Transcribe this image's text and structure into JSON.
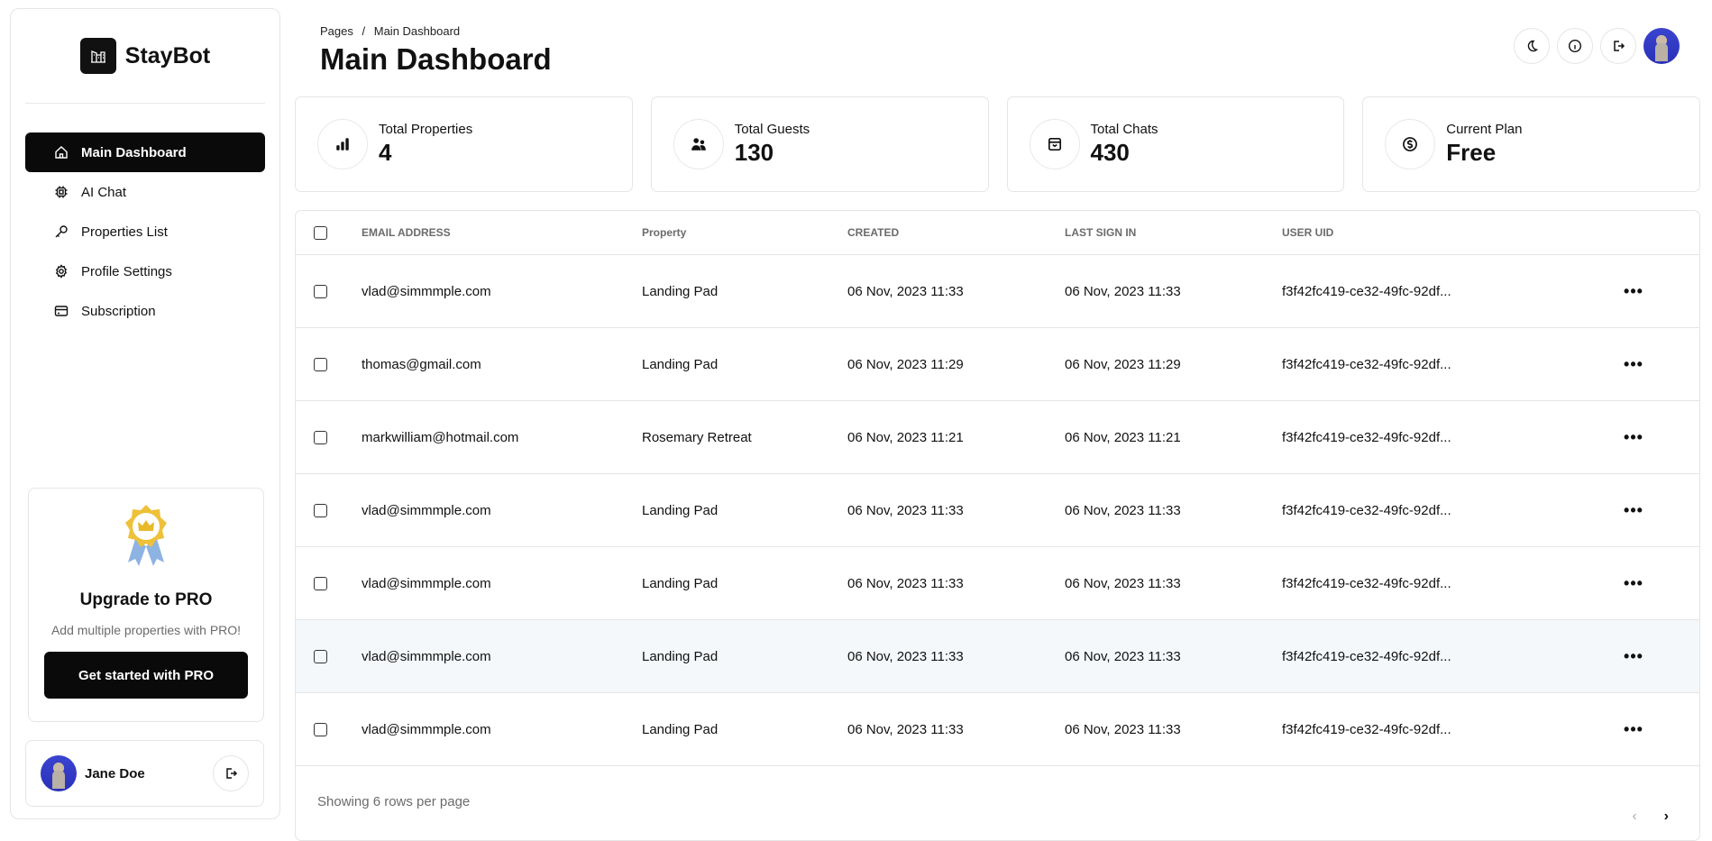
{
  "brand": {
    "name": "StayBot",
    "logo_icon": "building-icon"
  },
  "sidebar": {
    "items": [
      {
        "label": "Main Dashboard",
        "icon": "home-icon",
        "active": true
      },
      {
        "label": "AI Chat",
        "icon": "chip-icon",
        "active": false
      },
      {
        "label": "Properties List",
        "icon": "key-icon",
        "active": false
      },
      {
        "label": "Profile Settings",
        "icon": "gear-icon",
        "active": false
      },
      {
        "label": "Subscription",
        "icon": "credit-card-icon",
        "active": false
      }
    ],
    "promo": {
      "icon": "award-badge-icon",
      "title": "Upgrade to PRO",
      "subtitle": "Add multiple properties with PRO!",
      "button_label": "Get started with PRO"
    },
    "user": {
      "name": "Jane Doe",
      "logout_icon": "logout-icon"
    }
  },
  "header": {
    "breadcrumb": [
      "Pages",
      "/",
      "Main Dashboard"
    ],
    "title": "Main Dashboard",
    "actions": [
      "moon-icon",
      "info-icon",
      "logout-icon",
      "avatar"
    ]
  },
  "stats": [
    {
      "label": "Total Properties",
      "value": "4",
      "icon": "bar-chart-icon"
    },
    {
      "label": "Total Guests",
      "value": "130",
      "icon": "users-icon"
    },
    {
      "label": "Total Chats",
      "value": "430",
      "icon": "inbox-icon"
    },
    {
      "label": "Current Plan",
      "value": "Free",
      "icon": "dollar-icon"
    }
  ],
  "table": {
    "columns": [
      "EMAIL ADDRESS",
      "Property",
      "CREATED",
      "LAST SIGN IN",
      "USER UID"
    ],
    "rows": [
      {
        "email": "vlad@simmmple.com",
        "property": "Landing Pad",
        "created": "06 Nov, 2023 11:33",
        "last_sign_in": "06 Nov, 2023 11:33",
        "uid": "f3f42fc419-ce32-49fc-92df...",
        "action": "•••"
      },
      {
        "email": "thomas@gmail.com",
        "property": "Landing Pad",
        "created": "06 Nov, 2023 11:29",
        "last_sign_in": "06 Nov, 2023 11:29",
        "uid": "f3f42fc419-ce32-49fc-92df...",
        "action": "•••"
      },
      {
        "email": "markwilliam@hotmail.com",
        "property": "Rosemary Retreat",
        "created": "06 Nov, 2023 11:21",
        "last_sign_in": "06 Nov, 2023 11:21",
        "uid": "f3f42fc419-ce32-49fc-92df...",
        "action": "•••"
      },
      {
        "email": "vlad@simmmple.com",
        "property": "Landing Pad",
        "created": "06 Nov, 2023 11:33",
        "last_sign_in": "06 Nov, 2023 11:33",
        "uid": "f3f42fc419-ce32-49fc-92df...",
        "action": "•••"
      },
      {
        "email": "vlad@simmmple.com",
        "property": "Landing Pad",
        "created": "06 Nov, 2023 11:33",
        "last_sign_in": "06 Nov, 2023 11:33",
        "uid": "f3f42fc419-ce32-49fc-92df...",
        "action": "•••"
      },
      {
        "email": "vlad@simmmple.com",
        "property": "Landing Pad",
        "created": "06 Nov, 2023 11:33",
        "last_sign_in": "06 Nov, 2023 11:33",
        "uid": "f3f42fc419-ce32-49fc-92df...",
        "action": "•••"
      },
      {
        "email": "vlad@simmmple.com",
        "property": "Landing Pad",
        "created": "06 Nov, 2023 11:33",
        "last_sign_in": "06 Nov, 2023 11:33",
        "uid": "f3f42fc419-ce32-49fc-92df...",
        "action": "•••"
      }
    ],
    "footer": {
      "rows_text": "Showing 6 rows per page",
      "prev": "‹",
      "next": "›"
    }
  }
}
